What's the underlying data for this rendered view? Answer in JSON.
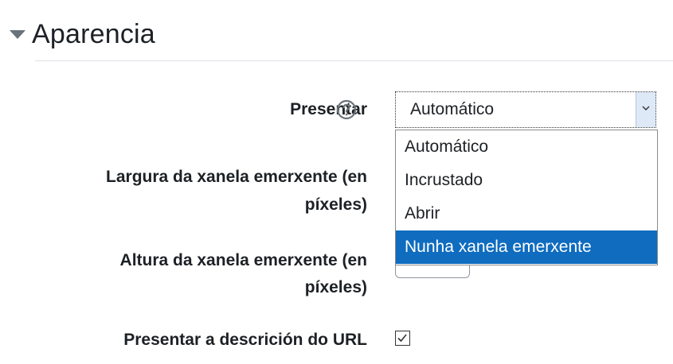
{
  "section": {
    "title": "Aparencia",
    "toggle_icon": "collapse-triangle-icon"
  },
  "form": {
    "display": {
      "label": "Presentar",
      "help_icon": "question-circle-icon",
      "selected_value": "Automático",
      "options": [
        "Automático",
        "Incrustado",
        "Abrir",
        "Nunha xanela emerxente"
      ],
      "highlighted_option": "Nunha xanela emerxente"
    },
    "popup_width": {
      "label_line1": "Largura da xanela emerxente (en",
      "label_line2": "píxeles)"
    },
    "popup_height": {
      "label_line1": "Altura da xanela emerxente (en",
      "label_line2": "píxeles)"
    },
    "show_description": {
      "label": "Presentar a descrición do URL",
      "checked": true
    }
  },
  "colors": {
    "highlight": "#0f6cbf",
    "text": "#1d2125"
  }
}
